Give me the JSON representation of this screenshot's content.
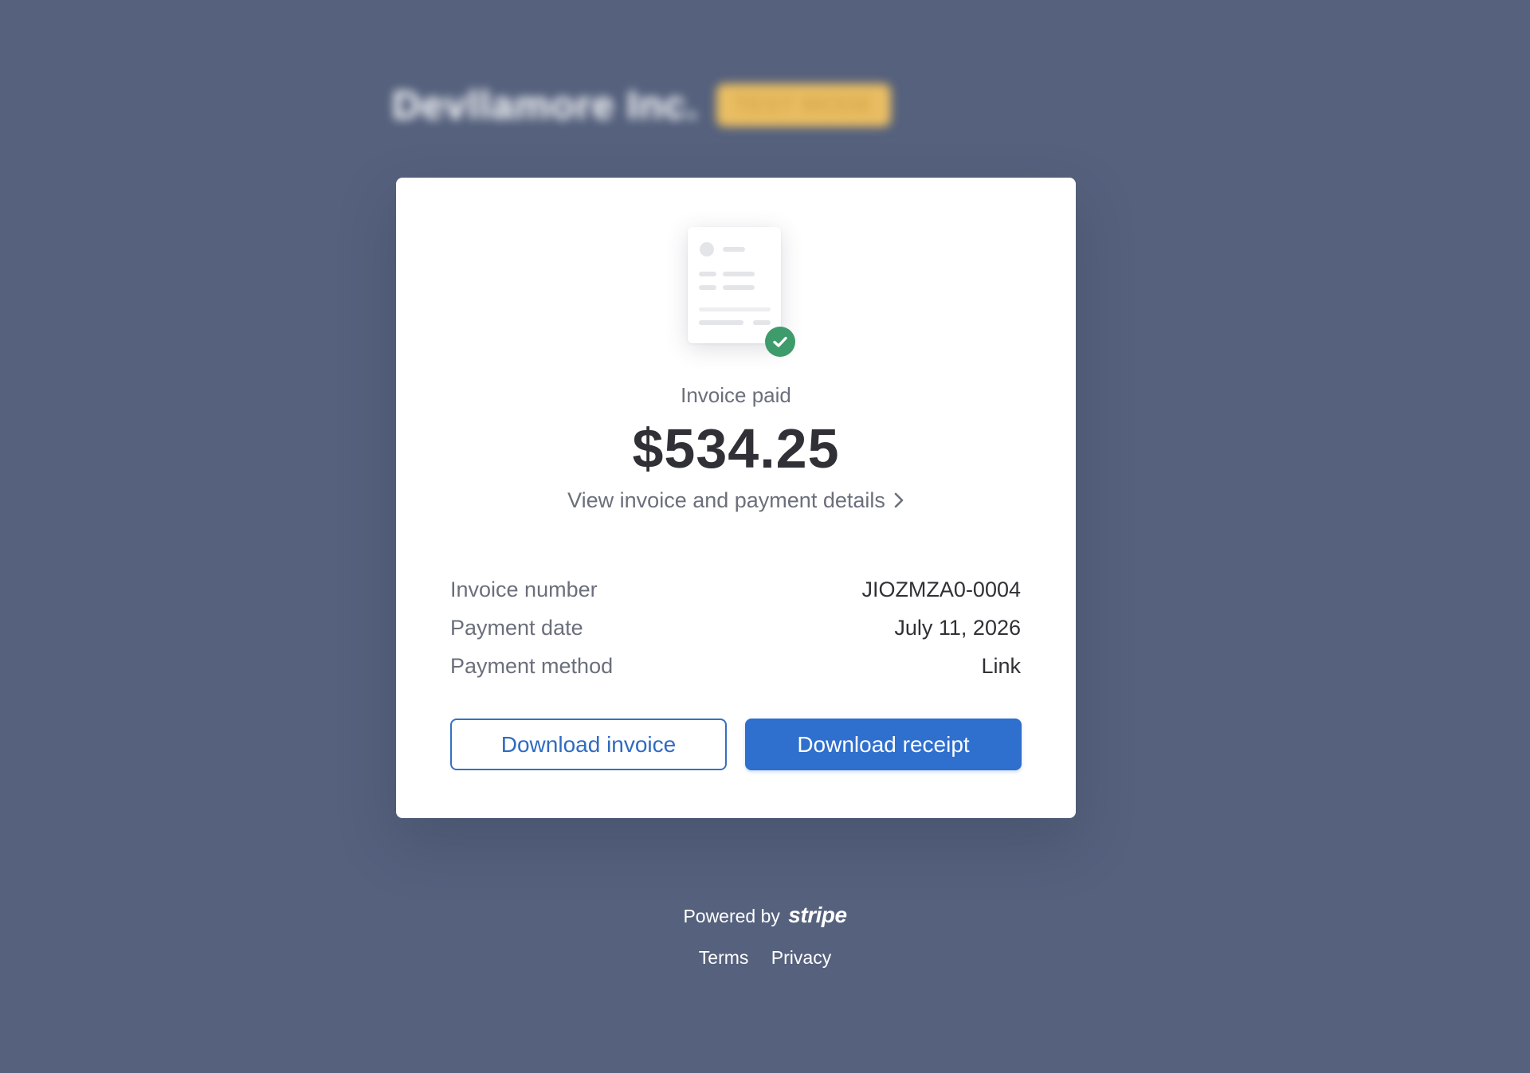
{
  "merchant": {
    "name": "Devllamore Inc.",
    "badge": "TEST MODE"
  },
  "status": {
    "label": "Invoice paid",
    "amount": "$534.25",
    "details_link": "View invoice and payment details"
  },
  "details": [
    {
      "label": "Invoice number",
      "value": "JIOZMZA0-0004"
    },
    {
      "label": "Payment date",
      "value": "July 11, 2026"
    },
    {
      "label": "Payment method",
      "value": "Link"
    }
  ],
  "actions": {
    "download_invoice": "Download invoice",
    "download_receipt": "Download receipt"
  },
  "footer": {
    "powered_by": "Powered by",
    "brand": "stripe",
    "terms": "Terms",
    "privacy": "Privacy"
  },
  "colors": {
    "background": "#55617d",
    "primary": "#2f6fcd",
    "success": "#3e9b6c"
  },
  "icons": {
    "illustration": "invoice-document-icon",
    "check": "check-circle-icon",
    "chevron": "chevron-right-icon"
  }
}
